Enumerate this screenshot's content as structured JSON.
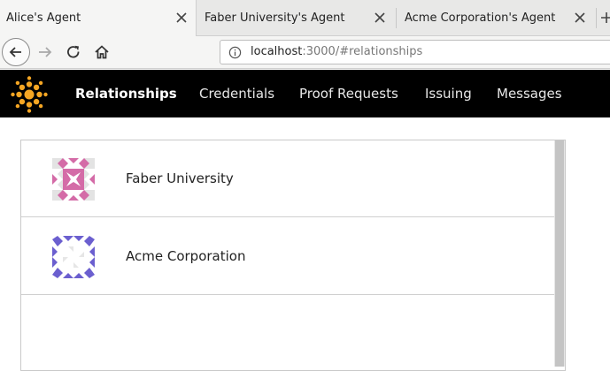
{
  "browser": {
    "tabs": [
      {
        "title": "Alice's Agent",
        "active": true
      },
      {
        "title": "Faber University's Agent",
        "active": false
      },
      {
        "title": "Acme Corporation's Agent",
        "active": false
      }
    ],
    "url": {
      "host": "localhost",
      "rest": ":3000/#relationships"
    }
  },
  "app": {
    "nav": [
      {
        "label": "Relationships",
        "active": true
      },
      {
        "label": "Credentials",
        "active": false
      },
      {
        "label": "Proof Requests",
        "active": false
      },
      {
        "label": "Issuing",
        "active": false
      },
      {
        "label": "Messages",
        "active": false
      }
    ]
  },
  "relationships": [
    {
      "name": "Faber University",
      "avatar_color": "#d46ba7"
    },
    {
      "name": "Acme Corporation",
      "avatar_color": "#6b5fcf"
    }
  ],
  "colors": {
    "brand_orange": "#f5a623",
    "header_bg": "#000000"
  }
}
